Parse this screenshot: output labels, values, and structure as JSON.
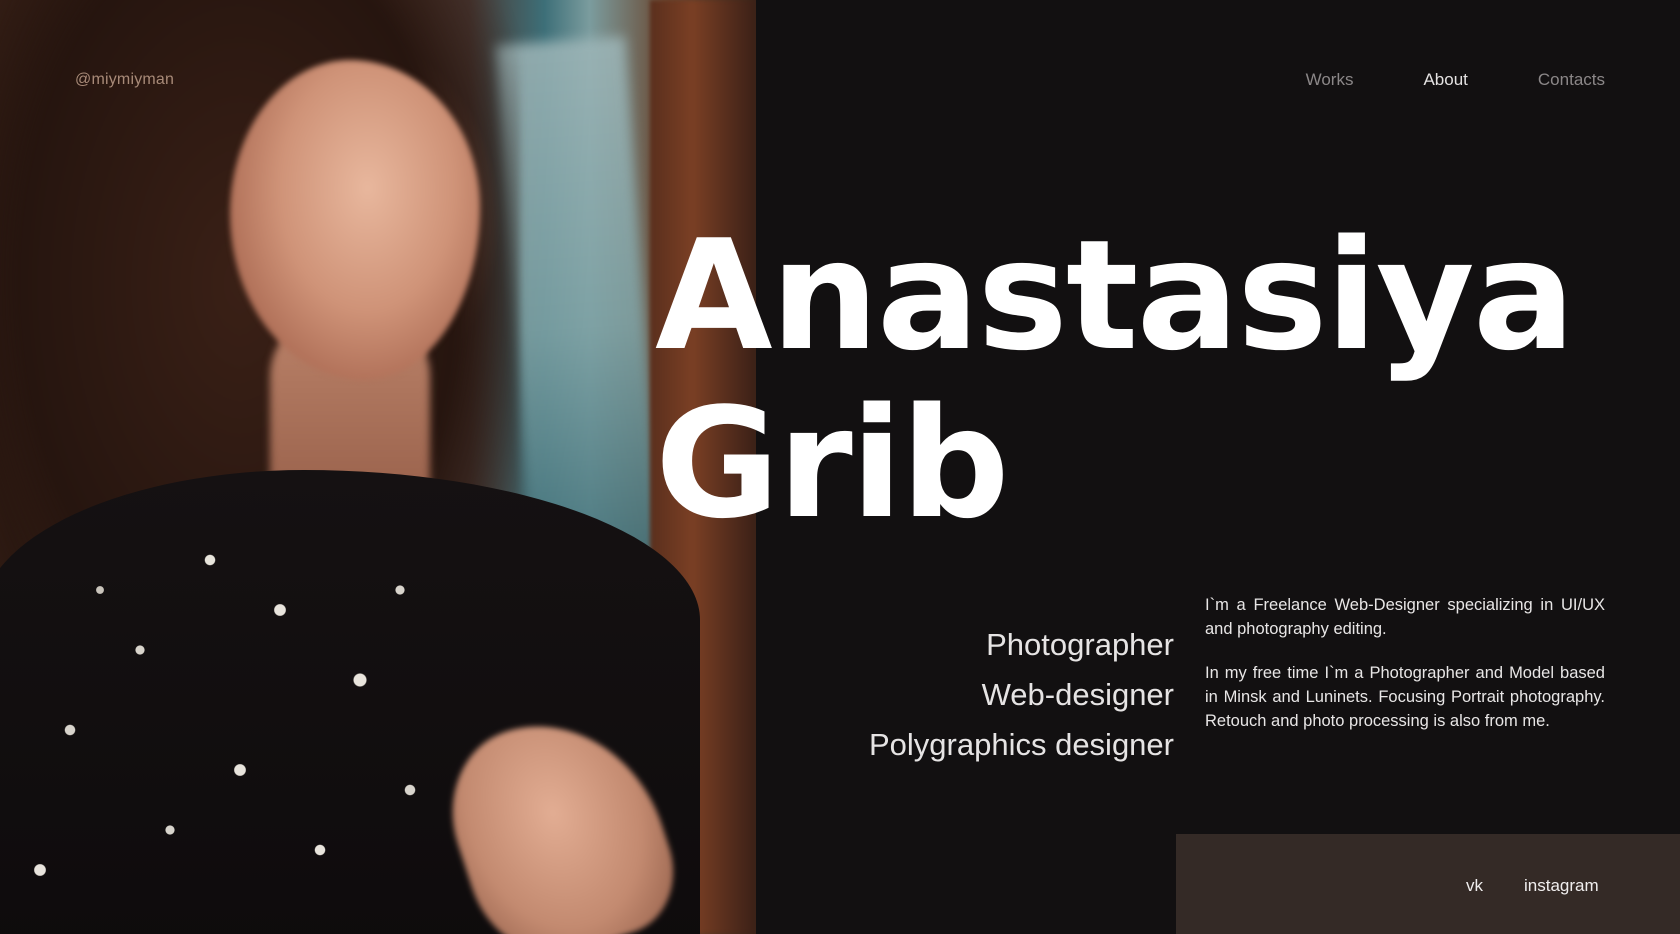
{
  "header": {
    "handle": "@miymiyman",
    "nav": [
      {
        "label": "Works",
        "active": false
      },
      {
        "label": "About",
        "active": true
      },
      {
        "label": "Contacts",
        "active": false
      }
    ]
  },
  "hero": {
    "first_name": "Anastasiya",
    "last_name": "Grib"
  },
  "roles": [
    "Photographer",
    "Web-designer",
    "Polygraphics designer"
  ],
  "bio": {
    "paragraph_1": "I`m a Freelance Web-Designer specializing in UI/UX and photography editing.",
    "paragraph_2": "In my free time I`m a Photographer and Model based in Minsk and Luninets. Focusing Portrait photography. Retouch and photo processing is also from me."
  },
  "social": {
    "vk": "vk",
    "instagram": "instagram"
  },
  "colors": {
    "background": "#121011",
    "social_bar": "#342a26",
    "handle": "#a88a78",
    "nav_inactive": "#8b8788",
    "nav_active": "#e4e2e2",
    "text": "#ffffff"
  }
}
